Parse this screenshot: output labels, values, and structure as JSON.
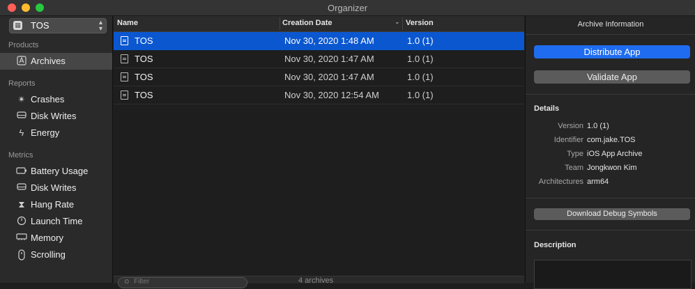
{
  "window": {
    "title": "Organizer"
  },
  "sidebar": {
    "scheme_selector": {
      "label": "TOS"
    },
    "sections": {
      "products": "Products",
      "reports": "Reports",
      "metrics": "Metrics"
    },
    "items": {
      "archives": "Archives",
      "crashes": "Crashes",
      "disk_writes_reports": "Disk Writes",
      "energy": "Energy",
      "battery_usage": "Battery Usage",
      "disk_writes_metrics": "Disk Writes",
      "hang_rate": "Hang Rate",
      "launch_time": "Launch Time",
      "memory": "Memory",
      "scrolling": "Scrolling"
    }
  },
  "table": {
    "columns": {
      "name": "Name",
      "creation_date": "Creation Date",
      "version": "Version"
    },
    "rows": [
      {
        "name": "TOS",
        "date": "Nov 30, 2020 1:48 AM",
        "version": "1.0 (1)"
      },
      {
        "name": "TOS",
        "date": "Nov 30, 2020 1:47 AM",
        "version": "1.0 (1)"
      },
      {
        "name": "TOS",
        "date": "Nov 30, 2020 1:47 AM",
        "version": "1.0 (1)"
      },
      {
        "name": "TOS",
        "date": "Nov 30, 2020 12:54 AM",
        "version": "1.0 (1)"
      }
    ],
    "footer": {
      "filter_placeholder": "Filter",
      "count": "4 archives"
    }
  },
  "inspector": {
    "title": "Archive Information",
    "distribute_button": "Distribute App",
    "validate_button": "Validate App",
    "details": {
      "heading": "Details",
      "version_key": "Version",
      "version_val": "1.0 (1)",
      "identifier_key": "Identifier",
      "identifier_val": "com.jake.TOS",
      "type_key": "Type",
      "type_val": "iOS App Archive",
      "team_key": "Team",
      "team_val": "Jongkwon Kim",
      "arch_key": "Architectures",
      "arch_val": "arm64"
    },
    "download_debug_button": "Download Debug Symbols",
    "description_heading": "Description"
  },
  "colors": {
    "selection": "#0b57d0",
    "primary_button": "#1f6cf0",
    "close": "#ff5f57",
    "minimize": "#febc2e",
    "maximize": "#28c840"
  }
}
